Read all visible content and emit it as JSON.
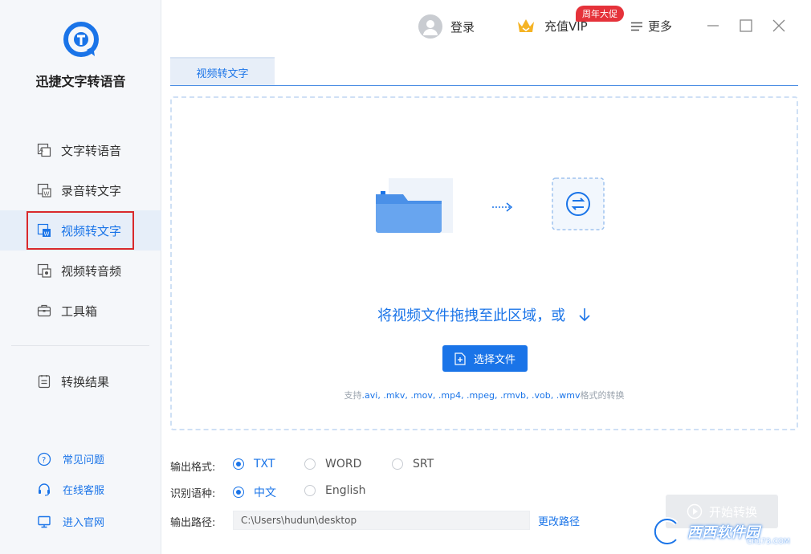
{
  "app": {
    "name": "迅捷文字转语音"
  },
  "sidebar": {
    "items": [
      {
        "label": "文字转语音",
        "icon": "text-to-speech-icon"
      },
      {
        "label": "录音转文字",
        "icon": "record-to-text-icon"
      },
      {
        "label": "视频转文字",
        "icon": "video-to-text-icon",
        "active": true
      },
      {
        "label": "视频转音频",
        "icon": "video-to-audio-icon"
      },
      {
        "label": "工具箱",
        "icon": "toolbox-icon"
      },
      {
        "label": "转换结果",
        "icon": "result-icon"
      }
    ],
    "help": [
      {
        "label": "常见问题",
        "icon": "question-icon"
      },
      {
        "label": "在线客服",
        "icon": "headset-icon"
      },
      {
        "label": "进入官网",
        "icon": "monitor-icon"
      }
    ]
  },
  "topbar": {
    "login": "登录",
    "vip": "充值VIP",
    "vip_badge": "周年大促",
    "more": "更多"
  },
  "tab": {
    "label": "视频转文字"
  },
  "dropzone": {
    "text": "将视频文件拖拽至此区域，或",
    "button": "选择文件",
    "support_prefix": "支持",
    "formats": ".avi, .mkv, .mov, .mp4, .mpeg, .rmvb, .vob, .wmv",
    "support_suffix": "格式的转换"
  },
  "options": {
    "format_label": "输出格式:",
    "formats": [
      {
        "label": "TXT",
        "selected": true
      },
      {
        "label": "WORD",
        "selected": false
      },
      {
        "label": "SRT",
        "selected": false
      }
    ],
    "language_label": "识别语种:",
    "languages": [
      {
        "label": "中文",
        "selected": true
      },
      {
        "label": "English",
        "selected": false
      }
    ],
    "path_label": "输出路径:",
    "path_value": "C:\\Users\\hudun\\desktop",
    "change_path": "更改路径",
    "start_button": "开始转换"
  },
  "watermark": {
    "text": "西西软件园",
    "sub": "CR173.COM"
  },
  "colors": {
    "accent": "#1a74e8",
    "sidebar_bg": "#f5f7fa",
    "active_bg": "#e6eef9",
    "badge": "#e5323a",
    "highlight_outline": "#d9292c"
  }
}
